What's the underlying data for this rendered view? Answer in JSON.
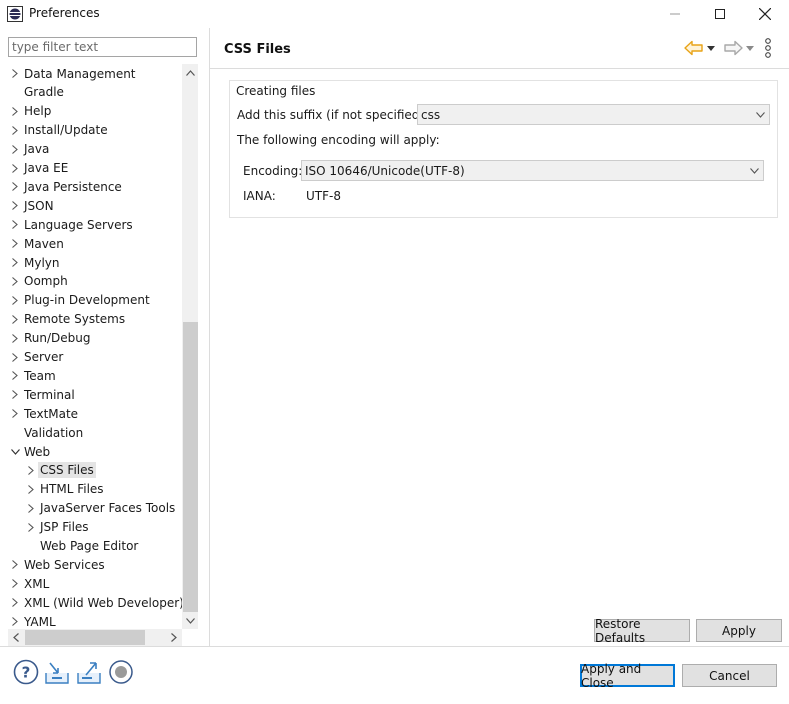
{
  "window": {
    "title": "Preferences"
  },
  "filter": {
    "placeholder": "type filter text"
  },
  "tree": {
    "items": [
      {
        "label": "Data Management",
        "expandable": true,
        "indent": 0
      },
      {
        "label": "Gradle",
        "expandable": false,
        "indent": 0
      },
      {
        "label": "Help",
        "expandable": true,
        "indent": 0
      },
      {
        "label": "Install/Update",
        "expandable": true,
        "indent": 0
      },
      {
        "label": "Java",
        "expandable": true,
        "indent": 0
      },
      {
        "label": "Java EE",
        "expandable": true,
        "indent": 0
      },
      {
        "label": "Java Persistence",
        "expandable": true,
        "indent": 0
      },
      {
        "label": "JSON",
        "expandable": true,
        "indent": 0
      },
      {
        "label": "Language Servers",
        "expandable": true,
        "indent": 0
      },
      {
        "label": "Maven",
        "expandable": true,
        "indent": 0
      },
      {
        "label": "Mylyn",
        "expandable": true,
        "indent": 0
      },
      {
        "label": "Oomph",
        "expandable": true,
        "indent": 0
      },
      {
        "label": "Plug-in Development",
        "expandable": true,
        "indent": 0
      },
      {
        "label": "Remote Systems",
        "expandable": true,
        "indent": 0
      },
      {
        "label": "Run/Debug",
        "expandable": true,
        "indent": 0
      },
      {
        "label": "Server",
        "expandable": true,
        "indent": 0
      },
      {
        "label": "Team",
        "expandable": true,
        "indent": 0
      },
      {
        "label": "Terminal",
        "expandable": true,
        "indent": 0
      },
      {
        "label": "TextMate",
        "expandable": true,
        "indent": 0
      },
      {
        "label": "Validation",
        "expandable": false,
        "indent": 0
      },
      {
        "label": "Web",
        "expandable": true,
        "expanded": true,
        "indent": 0
      },
      {
        "label": "CSS Files",
        "expandable": true,
        "indent": 1,
        "selected": true
      },
      {
        "label": "HTML Files",
        "expandable": true,
        "indent": 1
      },
      {
        "label": "JavaServer Faces Tools",
        "expandable": true,
        "indent": 1
      },
      {
        "label": "JSP Files",
        "expandable": true,
        "indent": 1
      },
      {
        "label": "Web Page Editor",
        "expandable": false,
        "indent": 1
      },
      {
        "label": "Web Services",
        "expandable": true,
        "indent": 0
      },
      {
        "label": "XML",
        "expandable": true,
        "indent": 0
      },
      {
        "label": "XML (Wild Web Developer)",
        "expandable": true,
        "indent": 0
      },
      {
        "label": "YAML",
        "expandable": true,
        "indent": 0
      }
    ]
  },
  "page": {
    "title": "CSS Files",
    "group_label": "Creating files",
    "suffix_label": "Add this suffix (if not specified):",
    "suffix_value": "css",
    "encoding_note": "The following encoding will apply:",
    "encoding_label": "Encoding:",
    "encoding_value": "ISO 10646/Unicode(UTF-8)",
    "iana_label": "IANA:",
    "iana_value": "UTF-8",
    "restore_defaults": "Restore Defaults",
    "apply": "Apply"
  },
  "footer": {
    "apply_and_close": "Apply and Close",
    "cancel": "Cancel"
  },
  "colors": {
    "back_arrow": "#e8a317",
    "accent_blue": "#3a7fc1",
    "default_button_border": "#0078d7"
  }
}
